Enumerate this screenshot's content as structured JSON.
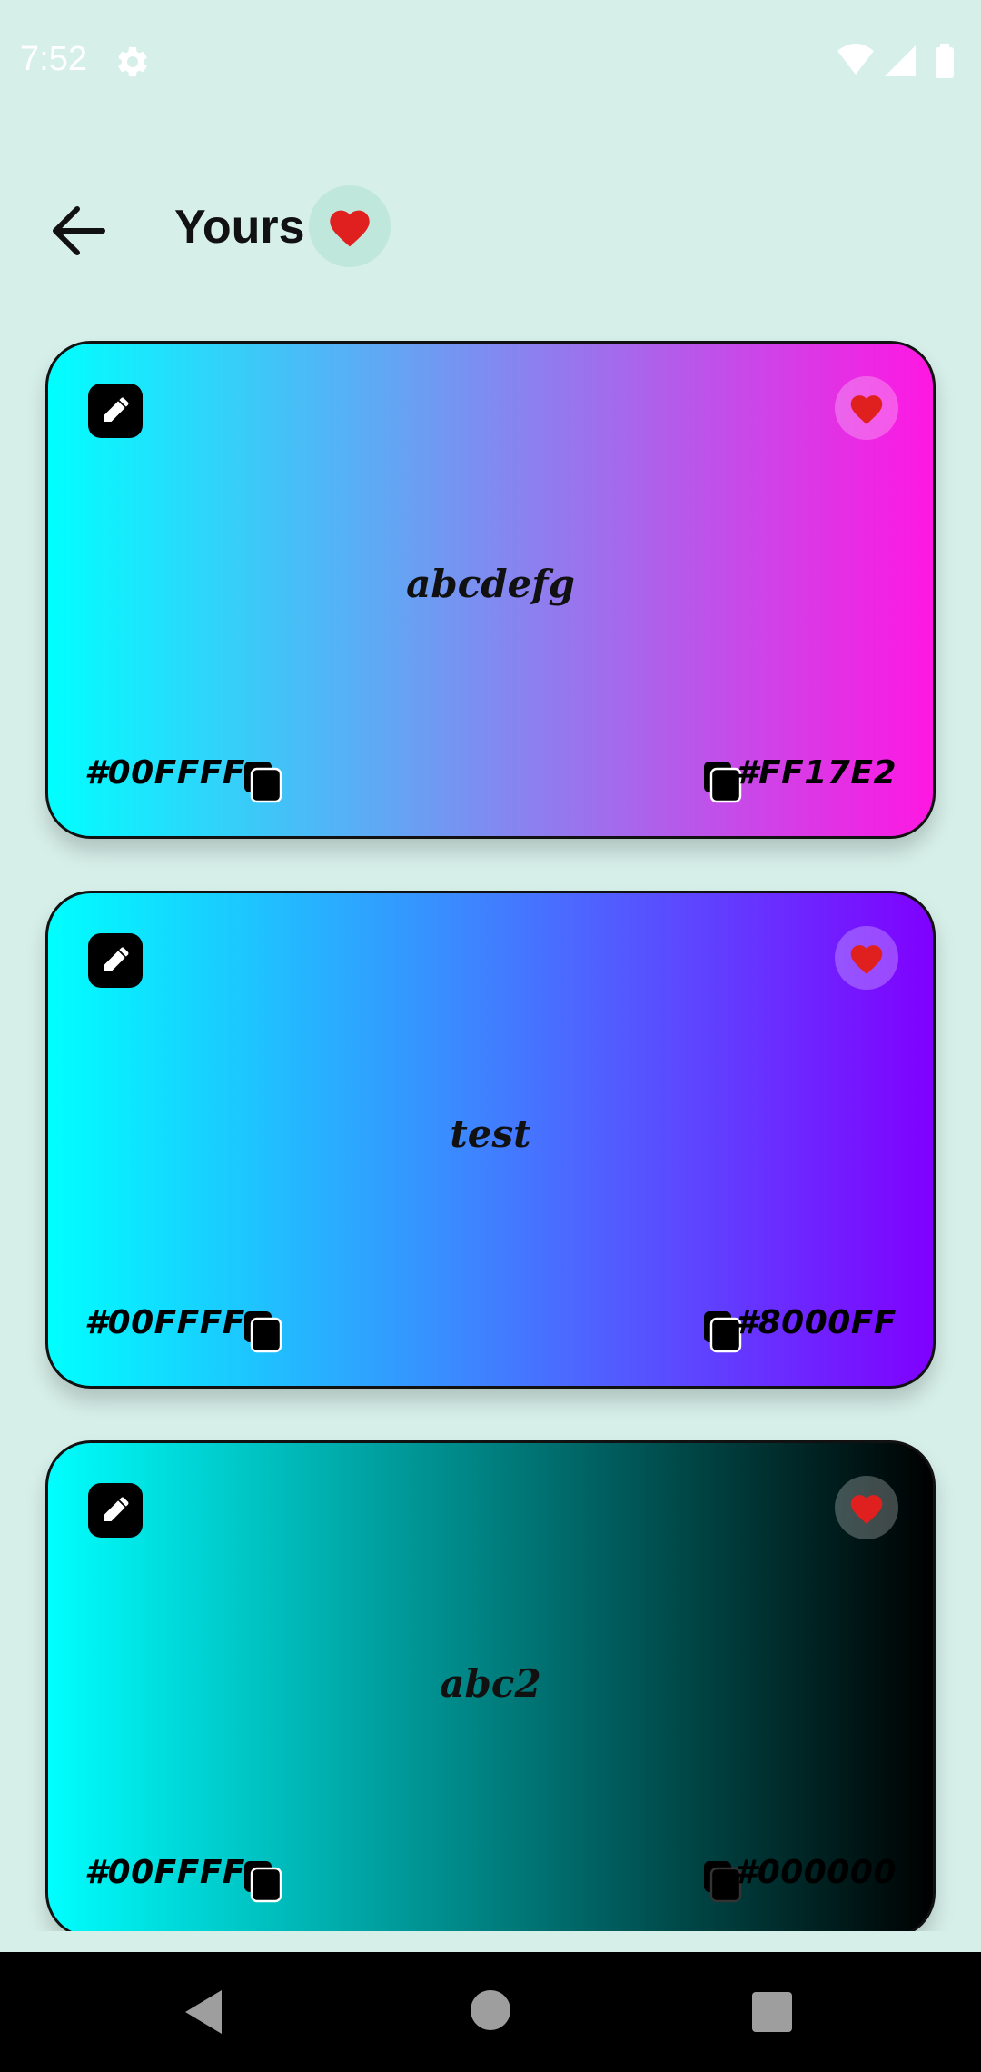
{
  "status_bar": {
    "time": "7:52",
    "icons": [
      "gear-icon",
      "wifi-icon",
      "signal-icon",
      "battery-icon"
    ]
  },
  "app_bar": {
    "title": "Yours",
    "back_icon": "arrow-left-icon",
    "title_badge_icon": "heart-icon"
  },
  "cards": [
    {
      "name": "abcdefg",
      "start_color": "#00FFFF",
      "end_color": "#FF17E2",
      "favorited": true
    },
    {
      "name": "test",
      "start_color": "#00FFFF",
      "end_color": "#8000FF",
      "favorited": true
    },
    {
      "name": "abc2",
      "start_color": "#00FFFF",
      "end_color": "#000000",
      "favorited": true
    }
  ],
  "colors": {
    "background": "#d7efe9",
    "heart": "#e0201f",
    "nav_bar": "#000000"
  },
  "nav_bar": {
    "buttons": [
      "back-triangle-icon",
      "home-circle-icon",
      "recents-square-icon"
    ]
  }
}
